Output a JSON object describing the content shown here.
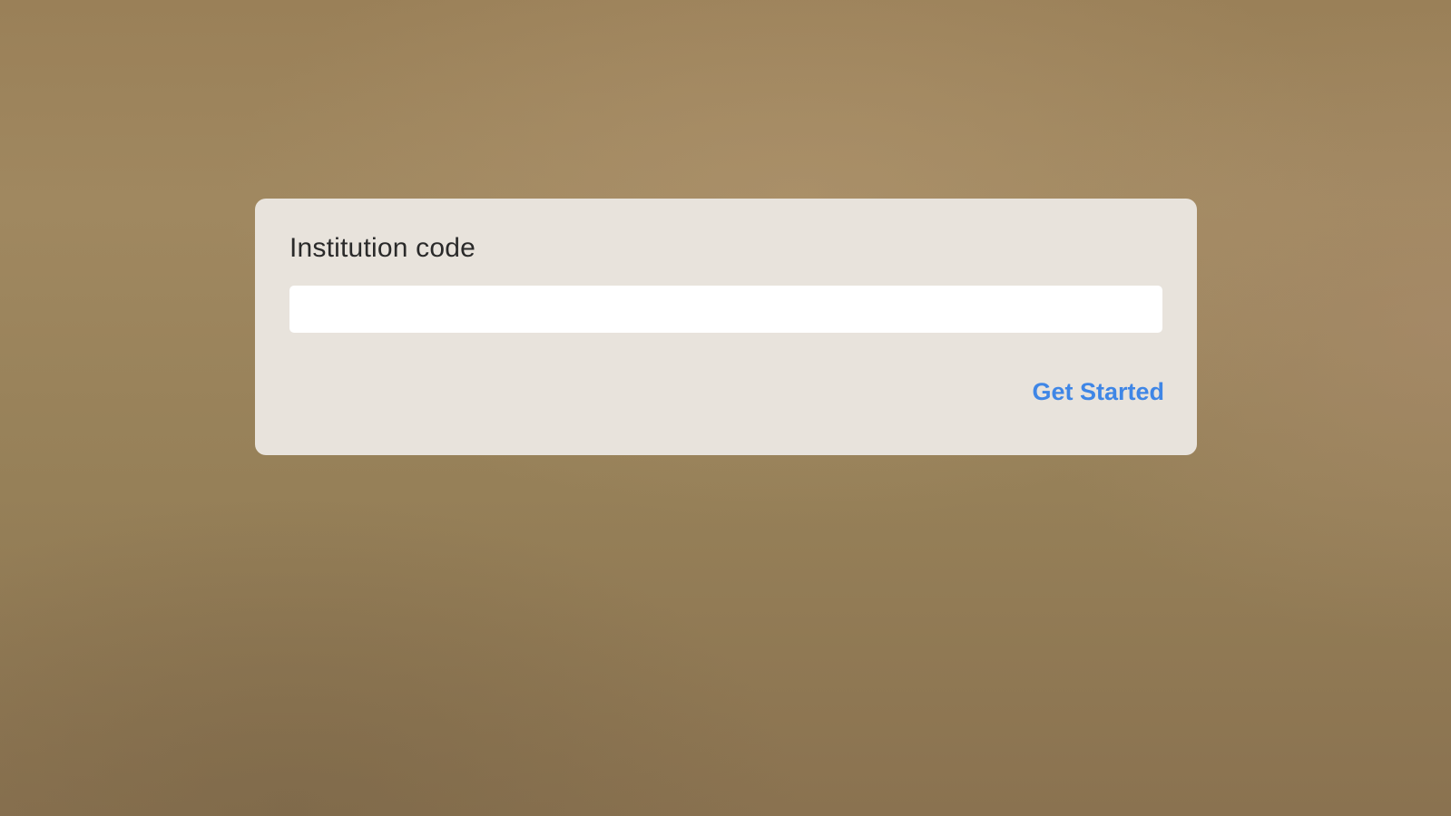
{
  "theme": {
    "accent": "#3f86e6",
    "card_bg": "#e8e3dc",
    "label_color": "#2a2a2a"
  },
  "form": {
    "label": "Institution code",
    "input_value": "",
    "input_placeholder": "",
    "submit_label": "Get Started"
  }
}
